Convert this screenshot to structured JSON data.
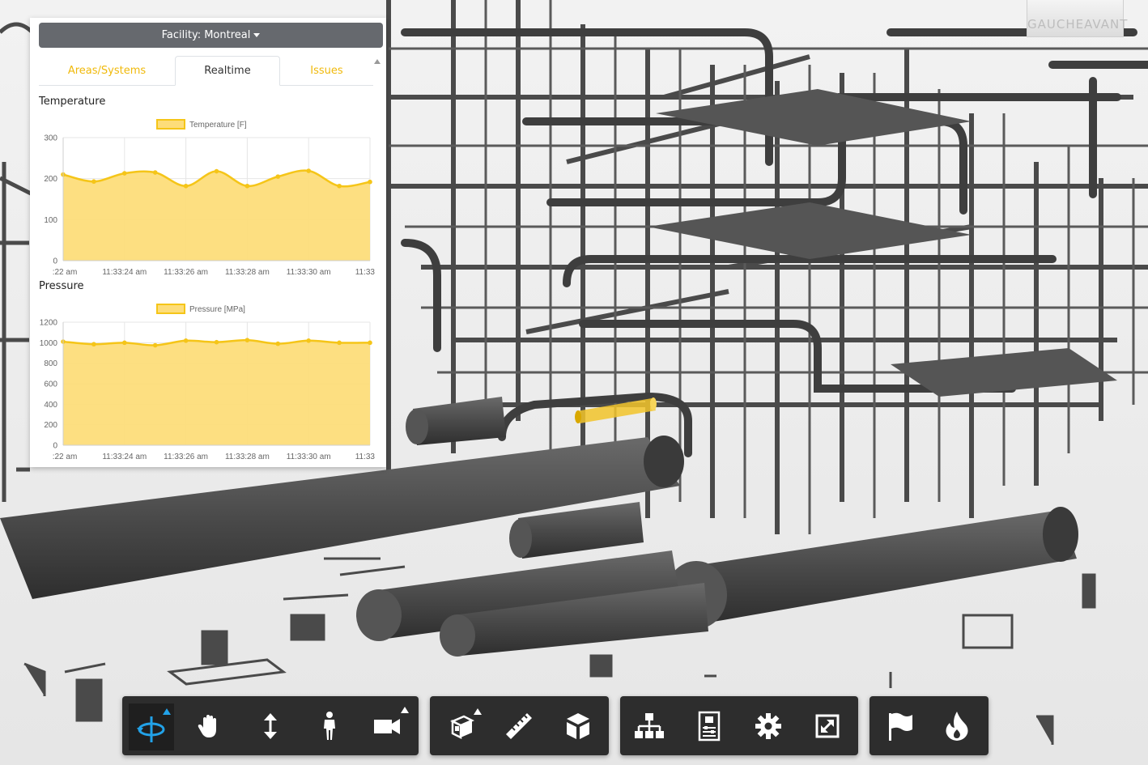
{
  "colors": {
    "accent_yellow": "#f5c518",
    "fill_yellow": "#fddd7a",
    "selection_yellow": "#f2c42a",
    "toolbar_bg": "#2d2d2d",
    "toolbar_active_icon": "#22a2e8",
    "model_gray": "#4a4a4a"
  },
  "viewcube": {
    "left_label": "GAUCHE",
    "right_label": "AVANT"
  },
  "panel": {
    "facility_label": "Facility: Montreal",
    "tabs": [
      {
        "label": "Areas/Systems",
        "active": false
      },
      {
        "label": "Realtime",
        "active": true
      },
      {
        "label": "Issues",
        "active": false
      }
    ]
  },
  "chart_data": [
    {
      "type": "area",
      "title": "Temperature",
      "legend": "Temperature [F]",
      "x_tick_labels": [
        ":22 am",
        "11:33:24 am",
        "11:33:26 am",
        "11:33:28 am",
        "11:33:30 am",
        "11:33"
      ],
      "y_ticks": [
        0,
        100,
        200,
        300
      ],
      "ylim": [
        0,
        300
      ],
      "values": [
        210,
        193,
        213,
        215,
        182,
        218,
        182,
        205,
        219,
        182,
        192
      ],
      "grid": true,
      "legend_position": "top-center"
    },
    {
      "type": "area",
      "title": "Pressure",
      "legend": "Pressure [MPa]",
      "x_tick_labels": [
        ":22 am",
        "11:33:24 am",
        "11:33:26 am",
        "11:33:28 am",
        "11:33:30 am",
        "11:33"
      ],
      "y_ticks": [
        0,
        200,
        400,
        600,
        800,
        1000,
        1200
      ],
      "ylim": [
        0,
        1200
      ],
      "values": [
        1010,
        985,
        1000,
        975,
        1020,
        1005,
        1025,
        990,
        1020,
        1000,
        1000
      ],
      "grid": true,
      "legend_position": "top-center"
    }
  ],
  "toolbar": {
    "groups": [
      {
        "buttons": [
          {
            "icon": "orbit-icon",
            "active": true,
            "submenu": true
          },
          {
            "icon": "pan-hand-icon",
            "active": false,
            "submenu": false
          },
          {
            "icon": "zoom-updown-icon",
            "active": false,
            "submenu": false
          },
          {
            "icon": "first-person-icon",
            "active": false,
            "submenu": false
          },
          {
            "icon": "camera-icon",
            "active": false,
            "submenu": true
          }
        ]
      },
      {
        "buttons": [
          {
            "icon": "explode-icon",
            "active": false,
            "submenu": true
          },
          {
            "icon": "measure-ruler-icon",
            "active": false,
            "submenu": false
          },
          {
            "icon": "section-cube-icon",
            "active": false,
            "submenu": false
          }
        ]
      },
      {
        "buttons": [
          {
            "icon": "model-browser-icon",
            "active": false,
            "submenu": false
          },
          {
            "icon": "properties-icon",
            "active": false,
            "submenu": false
          },
          {
            "icon": "settings-gear-icon",
            "active": false,
            "submenu": false
          },
          {
            "icon": "fullscreen-icon",
            "active": false,
            "submenu": false
          }
        ]
      },
      {
        "buttons": [
          {
            "icon": "flag-icon",
            "active": false,
            "submenu": false
          },
          {
            "icon": "flame-icon",
            "active": false,
            "submenu": false
          }
        ]
      }
    ]
  }
}
